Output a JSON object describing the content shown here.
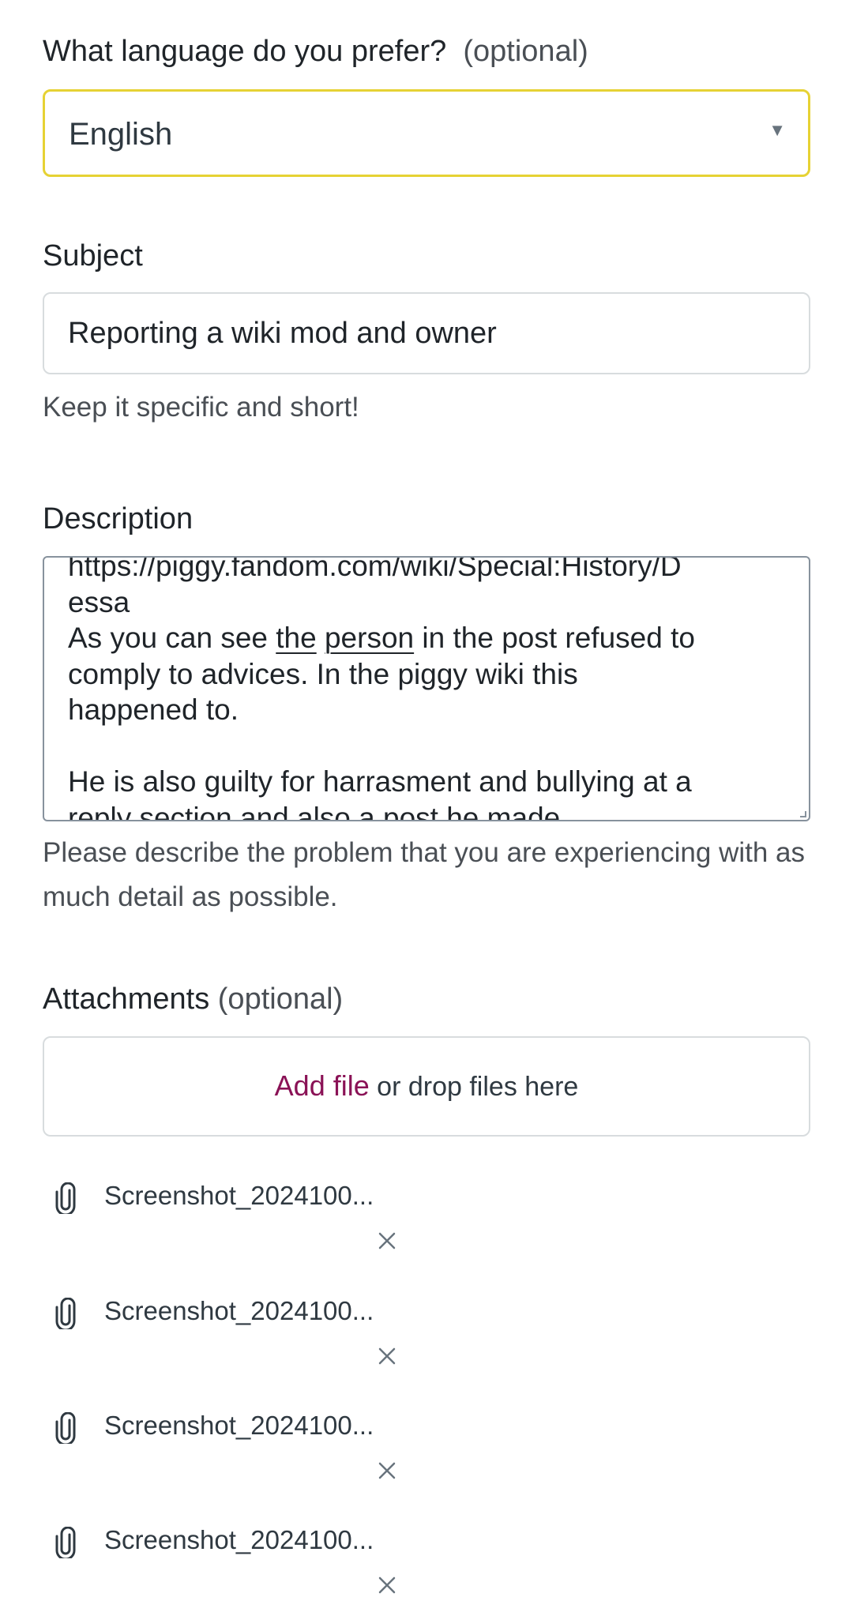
{
  "language": {
    "label": "What language do you prefer?",
    "optional": "(optional)",
    "selected": "English",
    "caret_icon": "triangle-down-icon"
  },
  "subject": {
    "label": "Subject",
    "value": "Reporting a wiki mod and owner",
    "hint": "Keep it specific and short!"
  },
  "description": {
    "label": "Description",
    "lines": {
      "line1": "https://piggy.fandom.com/wiki/Special:History/D",
      "line2": "essa",
      "line3_before": "As you can see ",
      "line3_u1": "the",
      "line3_space": " ",
      "line3_u2": "person",
      "line3_after": " in the post refused to",
      "line4": "comply to advices. In the piggy wiki this",
      "line5": "happened to.",
      "line6": "",
      "line7": "He is also guilty for harrasment and bullying at a",
      "line8": "reply section and also a post he made"
    },
    "hint": "Please describe the problem that you are experiencing with as much detail as possible."
  },
  "attachments": {
    "label": "Attachments",
    "optional": "(optional)",
    "add_file": "Add file",
    "drop_text": " or drop files here",
    "files": [
      {
        "name": "Screenshot_2024100..."
      },
      {
        "name": "Screenshot_2024100..."
      },
      {
        "name": "Screenshot_2024100..."
      },
      {
        "name": "Screenshot_2024100..."
      }
    ]
  },
  "colors": {
    "focus_border": "#e6d234",
    "link": "#8a1256"
  }
}
